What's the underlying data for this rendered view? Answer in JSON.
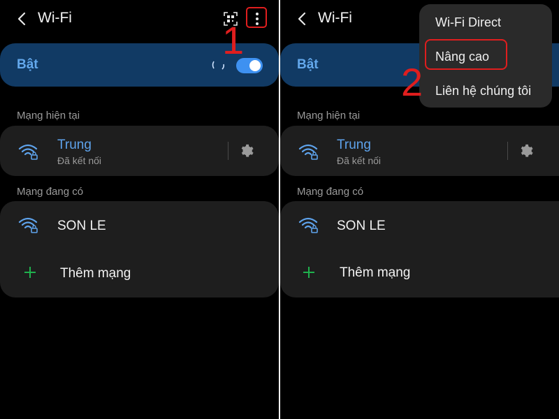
{
  "screen": {
    "title": "Wi-Fi",
    "toggle_label": "Bật",
    "current_network_section": "Mạng hiện tại",
    "current_network": {
      "name": "Trung",
      "status": "Đã kết nối"
    },
    "available_section": "Mạng đang có",
    "available_networks": [
      {
        "name": "SON LE"
      }
    ],
    "add_network_label": "Thêm mạng",
    "toggle_state": "on"
  },
  "overflow_menu": {
    "items": [
      {
        "label": "Wi-Fi Direct"
      },
      {
        "label": "Nâng cao"
      },
      {
        "label": "Liên hệ chúng tôi"
      }
    ],
    "highlighted_index": 1
  },
  "annotations": {
    "step1": "1",
    "step2": "2"
  },
  "colors": {
    "accent_blue": "#3e91f1",
    "network_name_blue": "#5ea3ec",
    "toggle_card_bg": "#113a64",
    "card_bg": "#1e1e1e",
    "highlight_red": "#e01e1e",
    "plus_green": "#1fb14d"
  },
  "icons": [
    "back-arrow-icon",
    "qr-scan-icon",
    "more-vertical-icon",
    "wifi-lock-icon",
    "gear-icon",
    "plus-icon",
    "loading-spinner-icon"
  ]
}
